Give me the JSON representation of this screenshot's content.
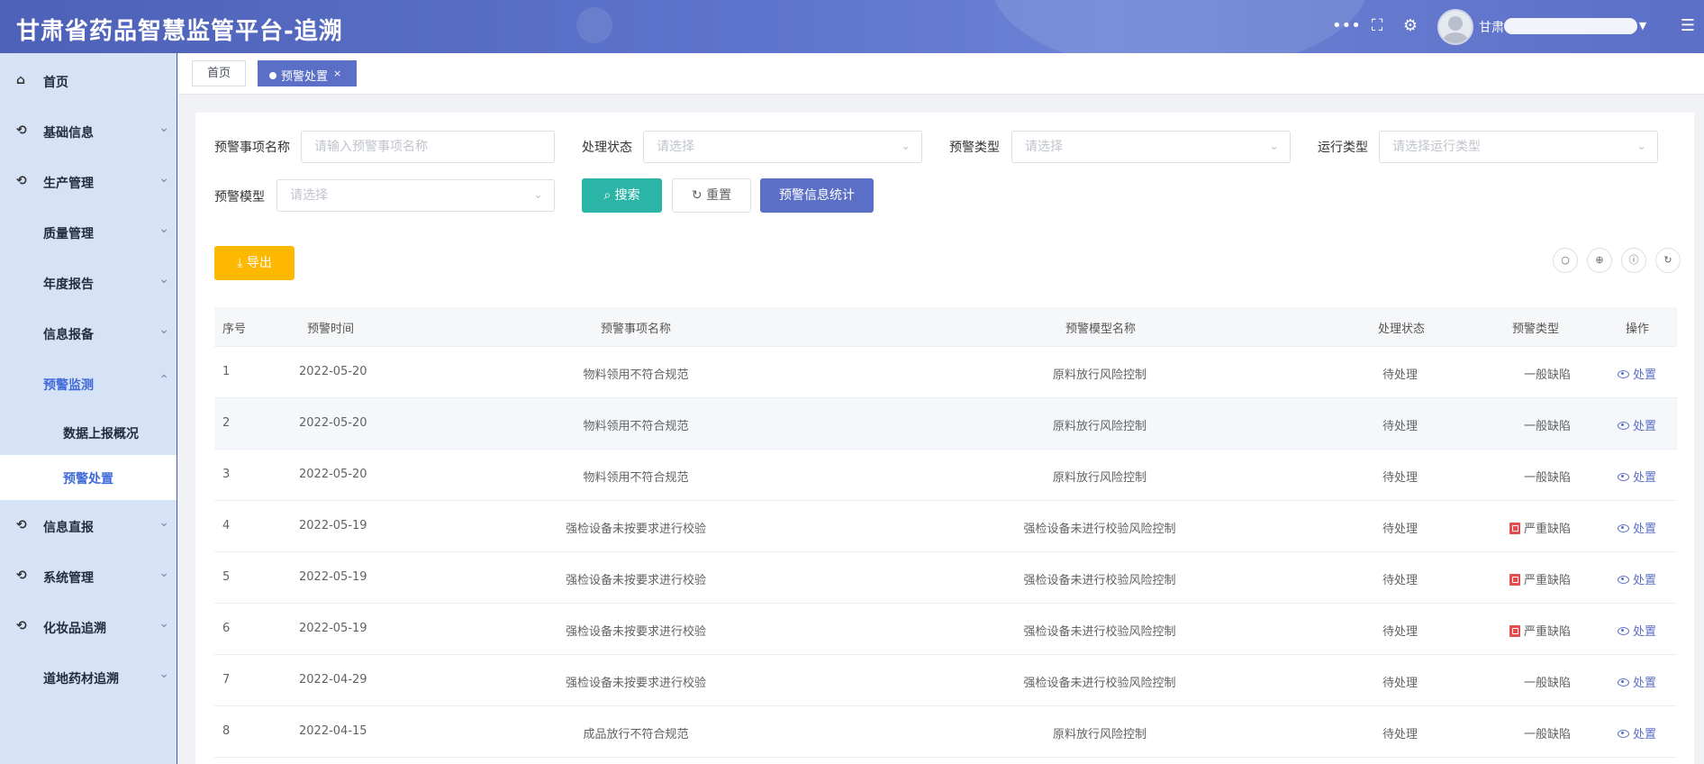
{
  "header": {
    "title": "甘肃省药品智慧监管平台-追溯",
    "username": "甘肃"
  },
  "tabs": [
    {
      "label": "首页"
    },
    {
      "label": "预警处置",
      "close": "×"
    }
  ],
  "sidebar": {
    "items": [
      {
        "label": "首页"
      },
      {
        "label": "基础信息"
      },
      {
        "label": "生产管理"
      },
      {
        "label": "质量管理"
      },
      {
        "label": "年度报告"
      },
      {
        "label": "信息报备"
      },
      {
        "label": "预警监测"
      },
      {
        "label": "数据上报概况"
      },
      {
        "label": "预警处置"
      },
      {
        "label": "信息直报"
      },
      {
        "label": "系统管理"
      },
      {
        "label": "化妆品追溯"
      },
      {
        "label": "道地药材追溯"
      }
    ]
  },
  "filters": {
    "name_label": "预警事项名称",
    "name_placeholder": "请输入预警事项名称",
    "status_label": "处理状态",
    "status_placeholder": "请选择",
    "type_label": "预警类型",
    "type_placeholder": "请选择",
    "run_label": "运行类型",
    "run_placeholder": "请选择运行类型",
    "model_label": "预警模型",
    "model_placeholder": "请选择"
  },
  "buttons": {
    "search": "搜索",
    "reset": "重置",
    "stats": "预警信息统计",
    "export": "导出"
  },
  "table": {
    "headers": [
      "序号",
      "预警时间",
      "预警事项名称",
      "预警模型名称",
      "处理状态",
      "预警类型",
      "操作"
    ],
    "rows": [
      {
        "no": "1",
        "time": "2022-05-20",
        "name": "物料领用不符合规范",
        "model": "原料放行风险控制",
        "status": "待处理",
        "type": "一般缺陷",
        "severe": false,
        "op": "处置"
      },
      {
        "no": "2",
        "time": "2022-05-20",
        "name": "物料领用不符合规范",
        "model": "原料放行风险控制",
        "status": "待处理",
        "type": "一般缺陷",
        "severe": false,
        "op": "处置"
      },
      {
        "no": "3",
        "time": "2022-05-20",
        "name": "物料领用不符合规范",
        "model": "原料放行风险控制",
        "status": "待处理",
        "type": "一般缺陷",
        "severe": false,
        "op": "处置"
      },
      {
        "no": "4",
        "time": "2022-05-19",
        "name": "强检设备未按要求进行校验",
        "model": "强检设备未进行校验风险控制",
        "status": "待处理",
        "type": "严重缺陷",
        "severe": true,
        "op": "处置"
      },
      {
        "no": "5",
        "time": "2022-05-19",
        "name": "强检设备未按要求进行校验",
        "model": "强检设备未进行校验风险控制",
        "status": "待处理",
        "type": "严重缺陷",
        "severe": true,
        "op": "处置"
      },
      {
        "no": "6",
        "time": "2022-05-19",
        "name": "强检设备未按要求进行校验",
        "model": "强检设备未进行校验风险控制",
        "status": "待处理",
        "type": "严重缺陷",
        "severe": true,
        "op": "处置"
      },
      {
        "no": "7",
        "time": "2022-04-29",
        "name": "强检设备未按要求进行校验",
        "model": "强检设备未进行校验风险控制",
        "status": "待处理",
        "type": "一般缺陷",
        "severe": false,
        "op": "处置"
      },
      {
        "no": "8",
        "time": "2022-04-15",
        "name": "成品放行不符合规范",
        "model": "原料放行风险控制",
        "status": "待处理",
        "type": "一般缺陷",
        "severe": false,
        "op": "处置"
      }
    ]
  },
  "colors": {
    "primary": "#5b6fc6",
    "search": "#2bb5a6",
    "export": "#ffb800",
    "severe": "#e34d4d"
  }
}
